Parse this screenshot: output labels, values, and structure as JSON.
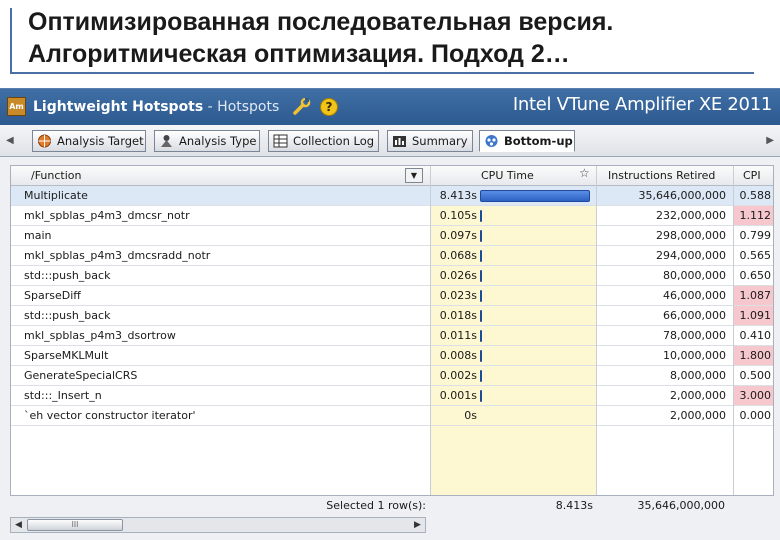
{
  "slide": {
    "title_line1": "Оптимизированная последовательная версия.",
    "title_line2": "Алгоритмическая оптимизация. Подход 2…"
  },
  "window": {
    "app_icon_text": "Am",
    "title_bold": "Lightweight Hotspots",
    "title_rest": " - Hotspots",
    "brand": "Intel VTune Amplifier XE 2011",
    "help_glyph": "?"
  },
  "tabs": [
    {
      "label": "Analysis Target",
      "icon": "globe-target-icon"
    },
    {
      "label": "Analysis Type",
      "icon": "analysis-type-icon"
    },
    {
      "label": "Collection Log",
      "icon": "log-grid-icon"
    },
    {
      "label": "Summary",
      "icon": "summary-icon"
    },
    {
      "label": "Bottom-up",
      "icon": "bottom-up-icon",
      "active": true
    }
  ],
  "grid": {
    "columns": {
      "function": "/Function",
      "cpu_time": "CPU Time",
      "instructions": "Instructions Retired",
      "cpi": "CPI"
    },
    "rows": [
      {
        "fn": "Multiplicate",
        "cpu": "8.413s",
        "cpu_value": 8.413,
        "inst": "35,646,000,000",
        "cpi": "0.588",
        "cpi_hot": false
      },
      {
        "fn": "mkl_spblas_p4m3_dmcsr_notr",
        "cpu": "0.105s",
        "cpu_value": 0.105,
        "inst": "232,000,000",
        "cpi": "1.112",
        "cpi_hot": true
      },
      {
        "fn": "main",
        "cpu": "0.097s",
        "cpu_value": 0.097,
        "inst": "298,000,000",
        "cpi": "0.799",
        "cpi_hot": false
      },
      {
        "fn": "mkl_spblas_p4m3_dmcsradd_notr",
        "cpu": "0.068s",
        "cpu_value": 0.068,
        "inst": "294,000,000",
        "cpi": "0.565",
        "cpi_hot": false
      },
      {
        "fn": "std:::push_back",
        "cpu": "0.026s",
        "cpu_value": 0.026,
        "inst": "80,000,000",
        "cpi": "0.650",
        "cpi_hot": false
      },
      {
        "fn": "SparseDiff",
        "cpu": "0.023s",
        "cpu_value": 0.023,
        "inst": "46,000,000",
        "cpi": "1.087",
        "cpi_hot": true
      },
      {
        "fn": "std:::push_back",
        "cpu": "0.018s",
        "cpu_value": 0.018,
        "inst": "66,000,000",
        "cpi": "1.091",
        "cpi_hot": true
      },
      {
        "fn": "mkl_spblas_p4m3_dsortrow",
        "cpu": "0.011s",
        "cpu_value": 0.011,
        "inst": "78,000,000",
        "cpi": "0.410",
        "cpi_hot": false
      },
      {
        "fn": "SparseMKLMult",
        "cpu": "0.008s",
        "cpu_value": 0.008,
        "inst": "10,000,000",
        "cpi": "1.800",
        "cpi_hot": true
      },
      {
        "fn": "GenerateSpecialCRS",
        "cpu": "0.002s",
        "cpu_value": 0.002,
        "inst": "8,000,000",
        "cpi": "0.500",
        "cpi_hot": false
      },
      {
        "fn": "std:::_Insert_n",
        "cpu": "0.001s",
        "cpu_value": 0.001,
        "inst": "2,000,000",
        "cpi": "3.000",
        "cpi_hot": true
      },
      {
        "fn": "`eh vector constructor iterator'",
        "cpu": "0s",
        "cpu_value": 0,
        "inst": "2,000,000",
        "cpi": "0.000",
        "cpi_hot": false
      }
    ],
    "footer": {
      "label": "Selected 1 row(s):",
      "cpu": "8.413s",
      "inst": "35,646,000,000"
    }
  },
  "scrollbar": {
    "thumb_glyph": "III"
  },
  "colors": {
    "titlebar": "#2d5a8f",
    "cpu_bar": "#2d62c4",
    "cpu_column_bg": "#fdf8d2",
    "cpi_hot_bg": "#f6c7cd",
    "selected_row": "#dde8f6"
  }
}
